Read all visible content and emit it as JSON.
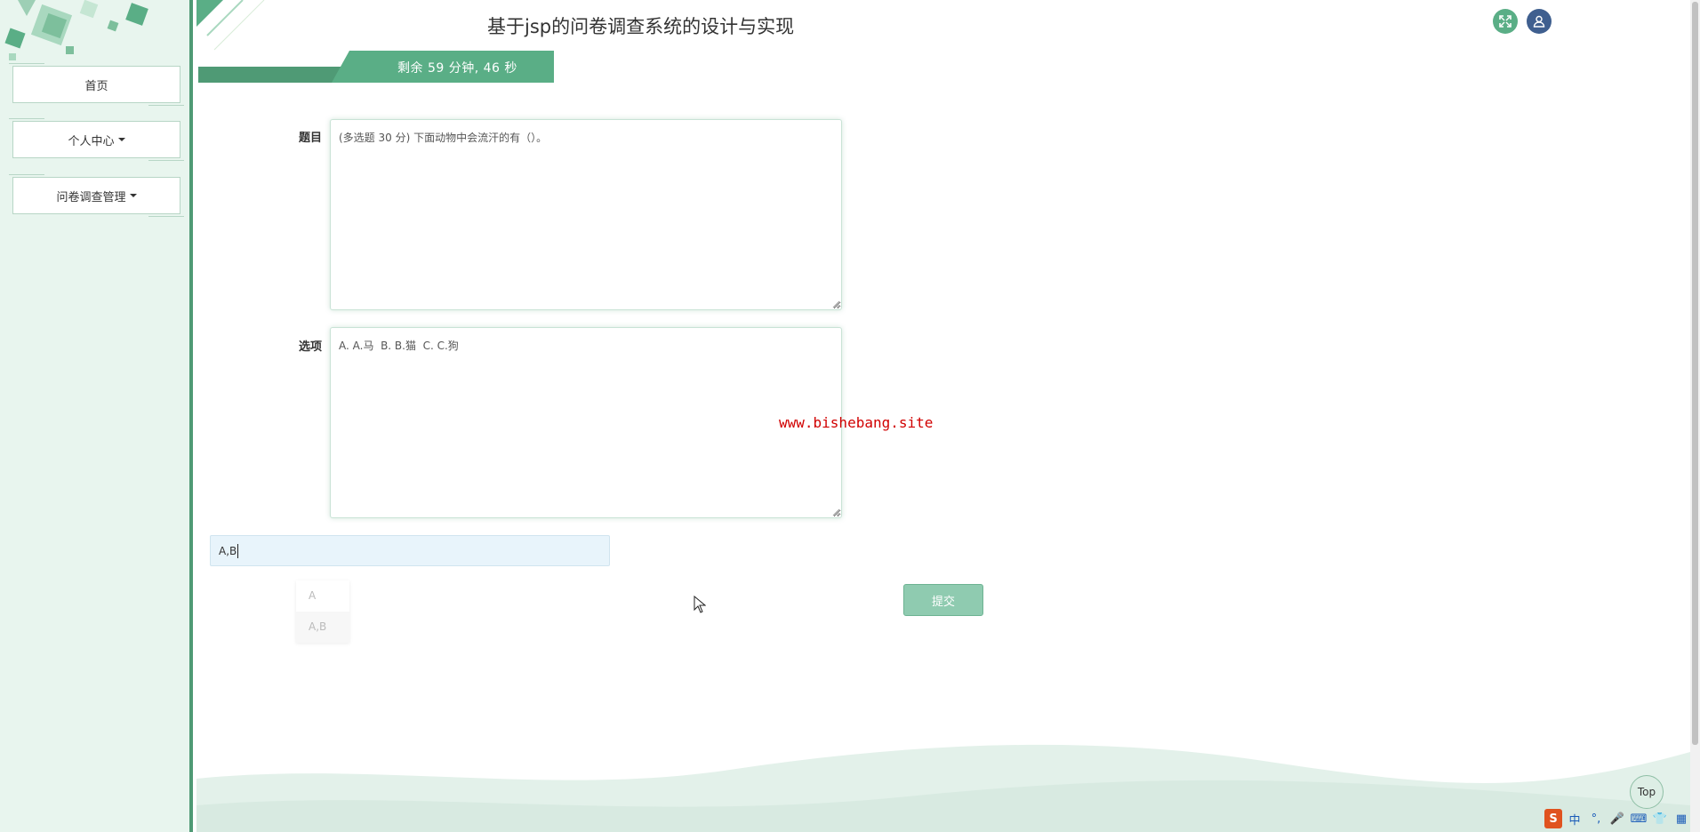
{
  "header": {
    "title": "基于jsp的问卷调查系统的设计与实现",
    "fullscreen_icon": "expand-icon",
    "user_icon": "user-icon",
    "accent_color": "#5aae86",
    "user_icon_color": "#3f5f8f"
  },
  "timer": {
    "text": "剩余 59 分钟, 46 秒"
  },
  "sidebar": {
    "items": [
      {
        "label": "首页",
        "has_caret": false
      },
      {
        "label": "个人中心",
        "has_caret": true
      },
      {
        "label": "问卷调查管理",
        "has_caret": true
      }
    ]
  },
  "form": {
    "question_label": "题目",
    "question_text": "(多选题 30 分) 下面动物中会流汗的有（）。",
    "options_label": "选项",
    "options_text": "A. A.马  B. B.猫  C. C.狗",
    "answer_value": "A,B",
    "suggestions": [
      "A",
      "A,B"
    ],
    "submit_label": "提交"
  },
  "watermark": "www.bishebang.site",
  "top_button_label": "Top",
  "ime": {
    "items": [
      "S",
      "中",
      "°,",
      "🎤",
      "⌨",
      "👕",
      "▦"
    ]
  }
}
